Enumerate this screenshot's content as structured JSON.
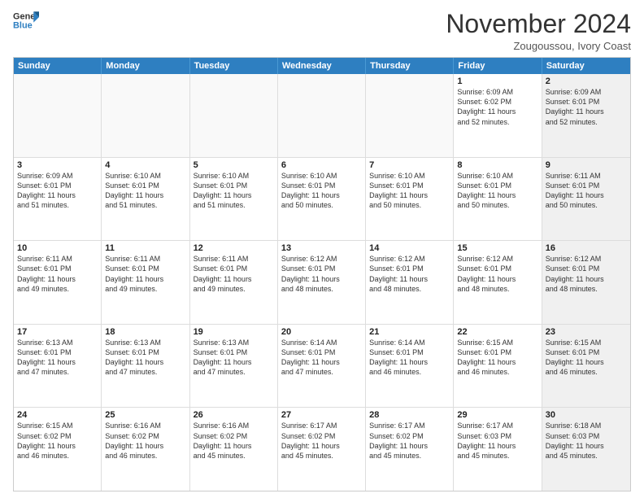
{
  "logo": {
    "line1": "General",
    "line2": "Blue"
  },
  "header": {
    "month": "November 2024",
    "location": "Zougoussou, Ivory Coast"
  },
  "weekdays": [
    "Sunday",
    "Monday",
    "Tuesday",
    "Wednesday",
    "Thursday",
    "Friday",
    "Saturday"
  ],
  "rows": [
    [
      {
        "day": "",
        "info": "",
        "shaded": false,
        "empty": true
      },
      {
        "day": "",
        "info": "",
        "shaded": false,
        "empty": true
      },
      {
        "day": "",
        "info": "",
        "shaded": false,
        "empty": true
      },
      {
        "day": "",
        "info": "",
        "shaded": false,
        "empty": true
      },
      {
        "day": "",
        "info": "",
        "shaded": false,
        "empty": true
      },
      {
        "day": "1",
        "info": "Sunrise: 6:09 AM\nSunset: 6:02 PM\nDaylight: 11 hours\nand 52 minutes.",
        "shaded": false,
        "empty": false
      },
      {
        "day": "2",
        "info": "Sunrise: 6:09 AM\nSunset: 6:01 PM\nDaylight: 11 hours\nand 52 minutes.",
        "shaded": true,
        "empty": false
      }
    ],
    [
      {
        "day": "3",
        "info": "Sunrise: 6:09 AM\nSunset: 6:01 PM\nDaylight: 11 hours\nand 51 minutes.",
        "shaded": false,
        "empty": false
      },
      {
        "day": "4",
        "info": "Sunrise: 6:10 AM\nSunset: 6:01 PM\nDaylight: 11 hours\nand 51 minutes.",
        "shaded": false,
        "empty": false
      },
      {
        "day": "5",
        "info": "Sunrise: 6:10 AM\nSunset: 6:01 PM\nDaylight: 11 hours\nand 51 minutes.",
        "shaded": false,
        "empty": false
      },
      {
        "day": "6",
        "info": "Sunrise: 6:10 AM\nSunset: 6:01 PM\nDaylight: 11 hours\nand 50 minutes.",
        "shaded": false,
        "empty": false
      },
      {
        "day": "7",
        "info": "Sunrise: 6:10 AM\nSunset: 6:01 PM\nDaylight: 11 hours\nand 50 minutes.",
        "shaded": false,
        "empty": false
      },
      {
        "day": "8",
        "info": "Sunrise: 6:10 AM\nSunset: 6:01 PM\nDaylight: 11 hours\nand 50 minutes.",
        "shaded": false,
        "empty": false
      },
      {
        "day": "9",
        "info": "Sunrise: 6:11 AM\nSunset: 6:01 PM\nDaylight: 11 hours\nand 50 minutes.",
        "shaded": true,
        "empty": false
      }
    ],
    [
      {
        "day": "10",
        "info": "Sunrise: 6:11 AM\nSunset: 6:01 PM\nDaylight: 11 hours\nand 49 minutes.",
        "shaded": false,
        "empty": false
      },
      {
        "day": "11",
        "info": "Sunrise: 6:11 AM\nSunset: 6:01 PM\nDaylight: 11 hours\nand 49 minutes.",
        "shaded": false,
        "empty": false
      },
      {
        "day": "12",
        "info": "Sunrise: 6:11 AM\nSunset: 6:01 PM\nDaylight: 11 hours\nand 49 minutes.",
        "shaded": false,
        "empty": false
      },
      {
        "day": "13",
        "info": "Sunrise: 6:12 AM\nSunset: 6:01 PM\nDaylight: 11 hours\nand 48 minutes.",
        "shaded": false,
        "empty": false
      },
      {
        "day": "14",
        "info": "Sunrise: 6:12 AM\nSunset: 6:01 PM\nDaylight: 11 hours\nand 48 minutes.",
        "shaded": false,
        "empty": false
      },
      {
        "day": "15",
        "info": "Sunrise: 6:12 AM\nSunset: 6:01 PM\nDaylight: 11 hours\nand 48 minutes.",
        "shaded": false,
        "empty": false
      },
      {
        "day": "16",
        "info": "Sunrise: 6:12 AM\nSunset: 6:01 PM\nDaylight: 11 hours\nand 48 minutes.",
        "shaded": true,
        "empty": false
      }
    ],
    [
      {
        "day": "17",
        "info": "Sunrise: 6:13 AM\nSunset: 6:01 PM\nDaylight: 11 hours\nand 47 minutes.",
        "shaded": false,
        "empty": false
      },
      {
        "day": "18",
        "info": "Sunrise: 6:13 AM\nSunset: 6:01 PM\nDaylight: 11 hours\nand 47 minutes.",
        "shaded": false,
        "empty": false
      },
      {
        "day": "19",
        "info": "Sunrise: 6:13 AM\nSunset: 6:01 PM\nDaylight: 11 hours\nand 47 minutes.",
        "shaded": false,
        "empty": false
      },
      {
        "day": "20",
        "info": "Sunrise: 6:14 AM\nSunset: 6:01 PM\nDaylight: 11 hours\nand 47 minutes.",
        "shaded": false,
        "empty": false
      },
      {
        "day": "21",
        "info": "Sunrise: 6:14 AM\nSunset: 6:01 PM\nDaylight: 11 hours\nand 46 minutes.",
        "shaded": false,
        "empty": false
      },
      {
        "day": "22",
        "info": "Sunrise: 6:15 AM\nSunset: 6:01 PM\nDaylight: 11 hours\nand 46 minutes.",
        "shaded": false,
        "empty": false
      },
      {
        "day": "23",
        "info": "Sunrise: 6:15 AM\nSunset: 6:01 PM\nDaylight: 11 hours\nand 46 minutes.",
        "shaded": true,
        "empty": false
      }
    ],
    [
      {
        "day": "24",
        "info": "Sunrise: 6:15 AM\nSunset: 6:02 PM\nDaylight: 11 hours\nand 46 minutes.",
        "shaded": false,
        "empty": false
      },
      {
        "day": "25",
        "info": "Sunrise: 6:16 AM\nSunset: 6:02 PM\nDaylight: 11 hours\nand 46 minutes.",
        "shaded": false,
        "empty": false
      },
      {
        "day": "26",
        "info": "Sunrise: 6:16 AM\nSunset: 6:02 PM\nDaylight: 11 hours\nand 45 minutes.",
        "shaded": false,
        "empty": false
      },
      {
        "day": "27",
        "info": "Sunrise: 6:17 AM\nSunset: 6:02 PM\nDaylight: 11 hours\nand 45 minutes.",
        "shaded": false,
        "empty": false
      },
      {
        "day": "28",
        "info": "Sunrise: 6:17 AM\nSunset: 6:02 PM\nDaylight: 11 hours\nand 45 minutes.",
        "shaded": false,
        "empty": false
      },
      {
        "day": "29",
        "info": "Sunrise: 6:17 AM\nSunset: 6:03 PM\nDaylight: 11 hours\nand 45 minutes.",
        "shaded": false,
        "empty": false
      },
      {
        "day": "30",
        "info": "Sunrise: 6:18 AM\nSunset: 6:03 PM\nDaylight: 11 hours\nand 45 minutes.",
        "shaded": true,
        "empty": false
      }
    ]
  ]
}
